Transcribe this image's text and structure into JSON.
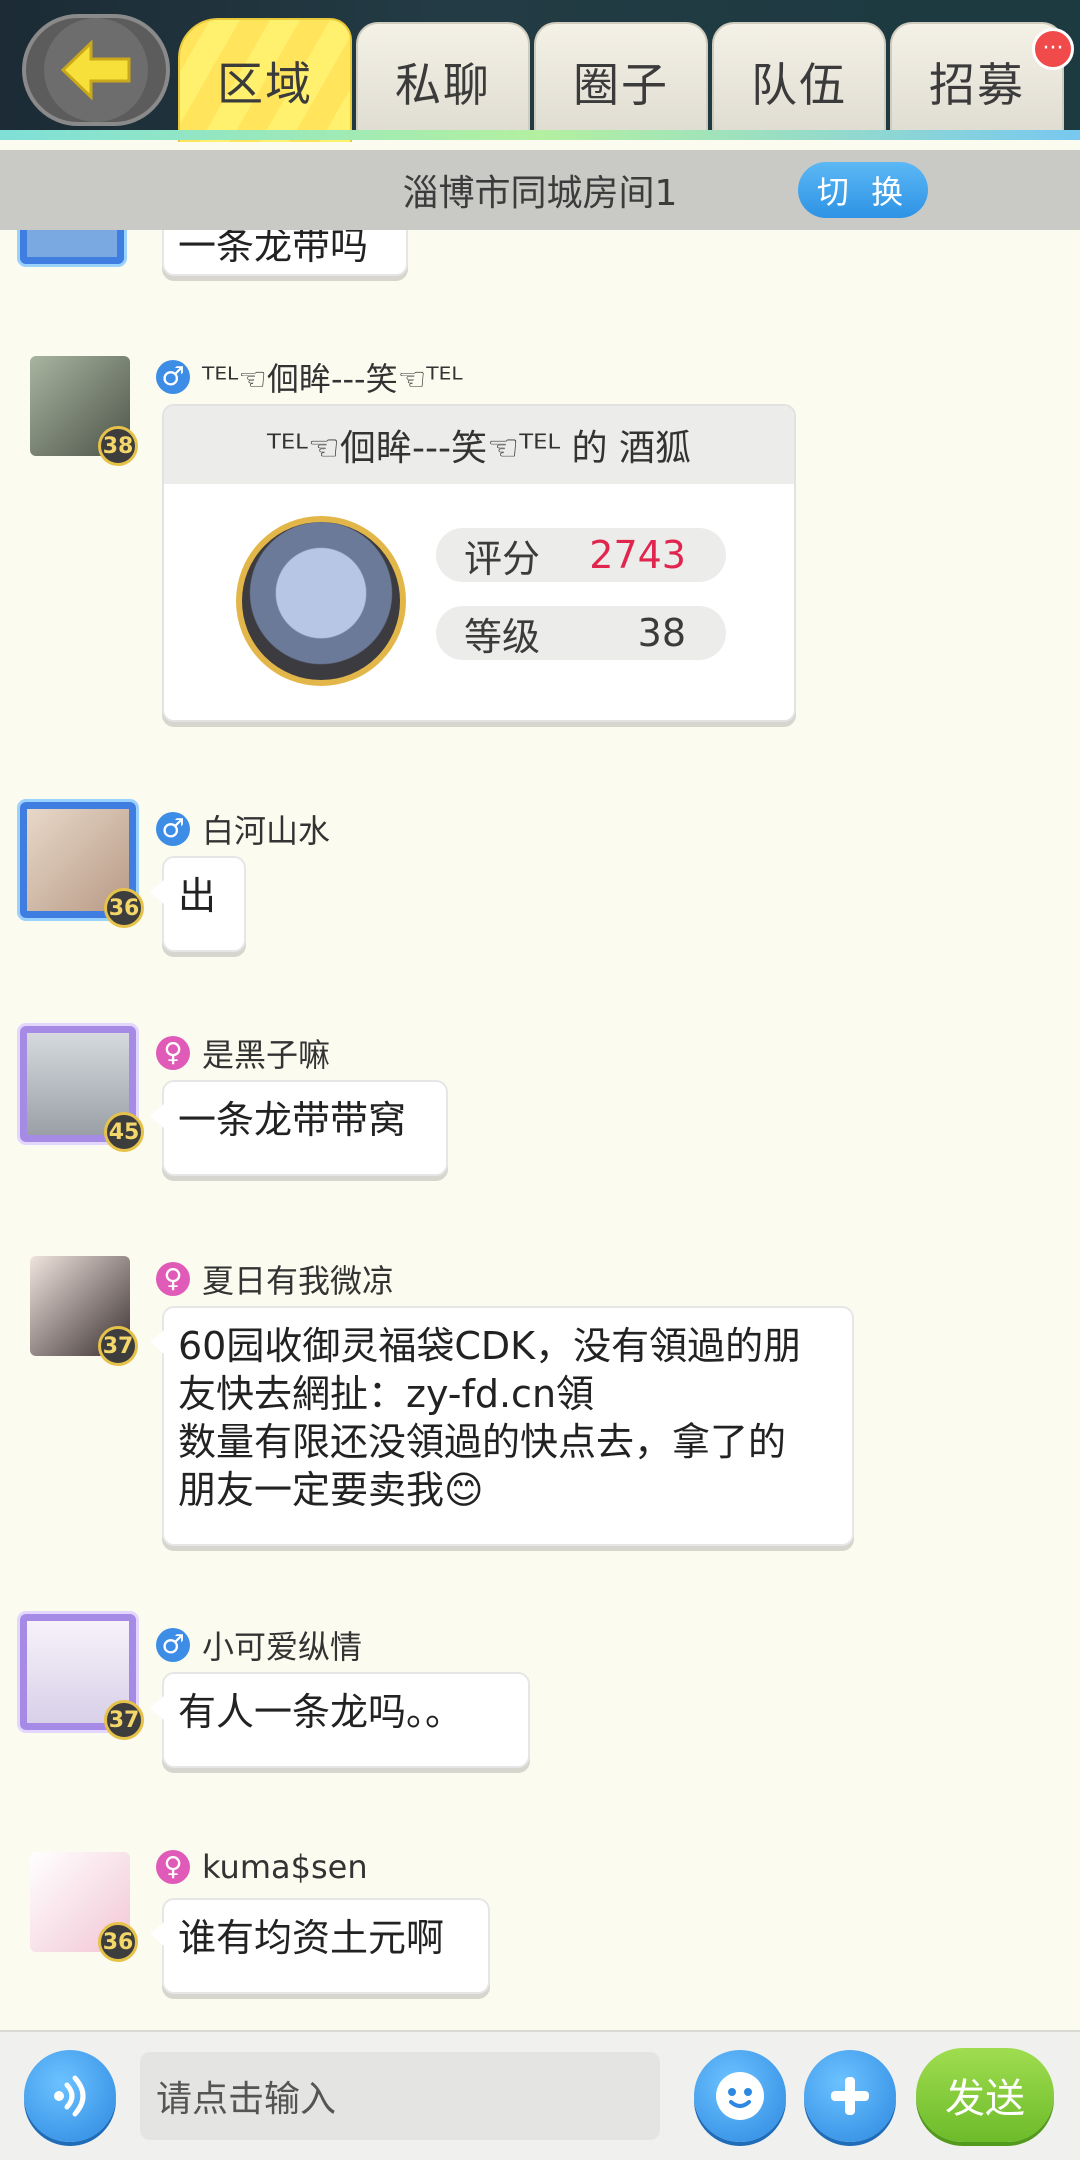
{
  "tabs": [
    {
      "label": "区域",
      "active": true
    },
    {
      "label": "私聊"
    },
    {
      "label": "圈子"
    },
    {
      "label": "队伍"
    },
    {
      "label": "招募"
    }
  ],
  "tab_badge": "···",
  "room": {
    "title": "淄博市同城房间1",
    "switch_label": "切 换"
  },
  "messages": {
    "partial": {
      "text": "一条龙带吗"
    },
    "m1": {
      "level": "38",
      "gender": "♂",
      "name": "ᵀᴱᴸ☜佪眸---笑☜ᵀᴱᴸ",
      "card_title": "ᵀᴱᴸ☜佪眸---笑☜ᵀᴱᴸ 的 酒狐",
      "score_label": "评分",
      "score": "2743",
      "grade_label": "等级",
      "grade": "38"
    },
    "m2": {
      "level": "36",
      "gender": "♂",
      "name": "白河山水",
      "text": "出"
    },
    "m3": {
      "level": "45",
      "gender": "♀",
      "name": "是黑子嘛",
      "text": "一条龙带带窝"
    },
    "m4": {
      "level": "37",
      "gender": "♀",
      "name": "夏日有我微凉",
      "line1": "60园收御灵福袋CDK，没有領過的朋",
      "line2": "友快去網扯：zy-fd.cn領",
      "line3": "数量有限还没領過的快点去，拿了的",
      "line4": "朋友一定要卖我😊"
    },
    "m5": {
      "level": "37",
      "gender": "♂",
      "name": "小可爱纵情",
      "text": "有人一条龙吗。。"
    },
    "m6": {
      "level": "36",
      "gender": "♀",
      "name": "kuma$sen",
      "text": "谁有均资土元啊"
    }
  },
  "input": {
    "placeholder": "请点击输入"
  },
  "send_label": "发送",
  "colors": {
    "accent_blue": "#2e93e5",
    "send_green": "#6dbb2a",
    "score_red": "#e0264e"
  }
}
